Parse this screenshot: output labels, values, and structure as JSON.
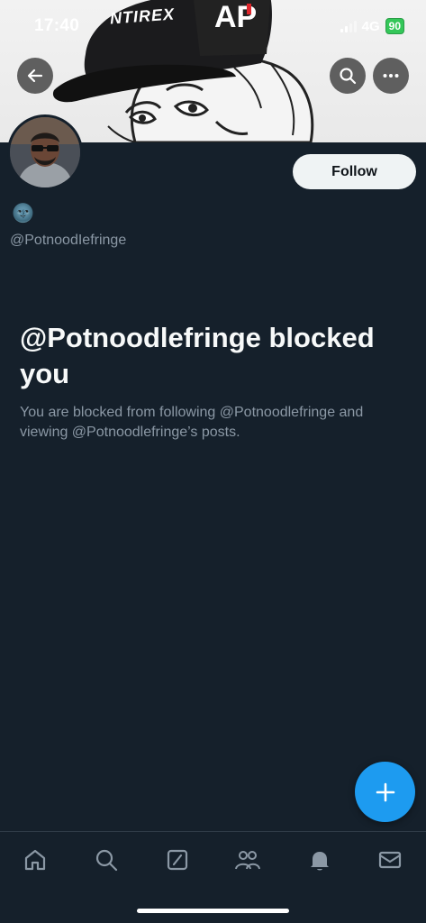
{
  "status_bar": {
    "time": "17:40",
    "network": "4G",
    "battery": "90"
  },
  "banner": {
    "cap_text_left": "NTIREX",
    "cap_text_right": "AP"
  },
  "header": {
    "back_icon": "arrow-left-icon",
    "search_icon": "search-icon",
    "more_icon": "more-horizontal-icon"
  },
  "profile": {
    "follow_label": "Follow",
    "emoji": "🌚",
    "handle": "@PotnoodIefringe"
  },
  "blocked": {
    "title": "@Potnoodlefringe blocked you",
    "description": "You are blocked from following @Potnoodlefringe and viewing @Potnoodlefringe’s posts."
  },
  "compose": {
    "icon": "plus-icon"
  },
  "tabs": [
    {
      "name": "home",
      "icon": "home-icon"
    },
    {
      "name": "search",
      "icon": "search-icon"
    },
    {
      "name": "grok",
      "icon": "grok-icon"
    },
    {
      "name": "communities",
      "icon": "people-icon"
    },
    {
      "name": "notifications",
      "icon": "bell-icon"
    },
    {
      "name": "messages",
      "icon": "mail-icon"
    }
  ],
  "colors": {
    "background": "#15202b",
    "accent": "#1d9bf0",
    "secondary_text": "#8b98a5",
    "battery": "#34c759"
  }
}
